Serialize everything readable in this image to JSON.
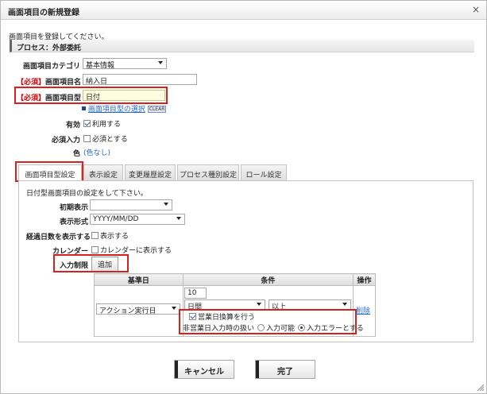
{
  "window": {
    "title": "画面項目の新規登録",
    "close": "×"
  },
  "intro": "画面項目を登録してください。",
  "process_section": "プロセス：外部委託",
  "form": {
    "category": {
      "label": "画面項目カテゴリ",
      "value": "基本情報"
    },
    "name": {
      "req": "【必須】",
      "label": "画面項目名",
      "value": "納入日"
    },
    "type": {
      "req": "【必須】",
      "label": "画面項目型",
      "value": "日付",
      "select_link": "画面項目型の選択",
      "clear": "CLEAR"
    },
    "enabled": {
      "label": "有効",
      "check_label": "利用する",
      "checked": true
    },
    "required_input": {
      "label": "必須入力",
      "check_label": "必須とする",
      "checked": false
    },
    "color": {
      "label": "色",
      "value": "(色なし)"
    }
  },
  "tabs": [
    "画面項目型設定",
    "表示設定",
    "変更履歴設定",
    "プロセス種別設定",
    "ロール設定"
  ],
  "panel": {
    "desc": "日付型画面項目の設定をして下さい。",
    "initial_display": {
      "label": "初期表示",
      "value": ""
    },
    "format": {
      "label": "表示形式",
      "value": "YYYY/MM/DD"
    },
    "elapsed_days": {
      "label": "経過日数を表示する",
      "check_label": "表示する",
      "checked": false
    },
    "calendar": {
      "label": "カレンダー",
      "check_label": "カレンダーに表示する",
      "checked": false
    },
    "input_limit": {
      "label": "入力制限",
      "add_button": "追加"
    },
    "table": {
      "headers": [
        "基準日",
        "条件",
        "操作"
      ],
      "row": {
        "base_date": "アクション実行日",
        "number": "10",
        "unit": "日間",
        "comparison": "以上",
        "business_day": {
          "label": "営業日換算を行う",
          "checked": true
        },
        "non_business_label": "非営業日入力時の扱い",
        "options": [
          "入力可能",
          "入力エラーとする"
        ],
        "selected_option": "入力エラーとする",
        "delete": "削除"
      }
    }
  },
  "buttons": {
    "cancel": "キャンセル",
    "done": "完了"
  }
}
